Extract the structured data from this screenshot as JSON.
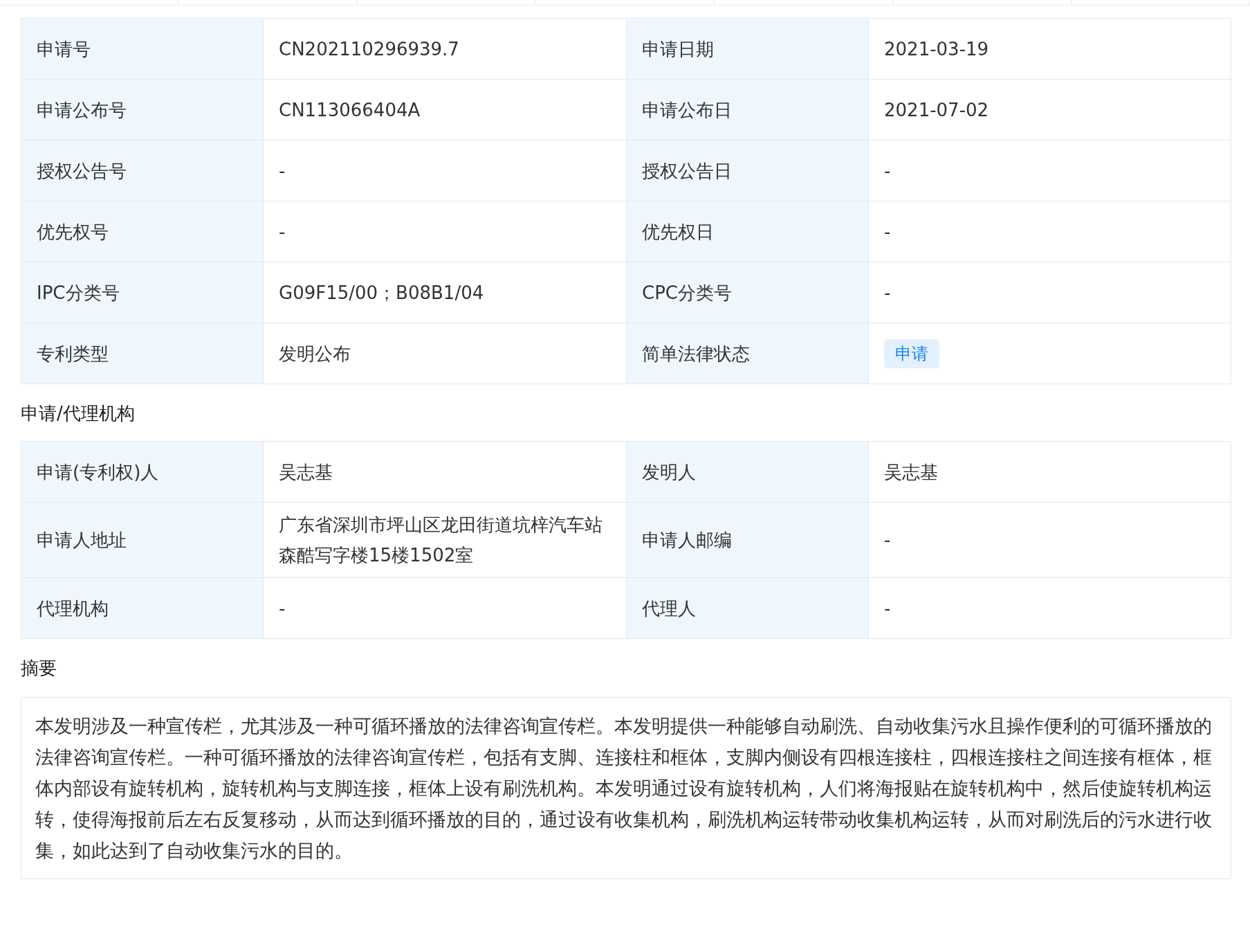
{
  "basic_info": {
    "rows": [
      [
        {
          "label": "申请号",
          "value": "CN202110296939.7"
        },
        {
          "label": "申请日期",
          "value": "2021-03-19"
        }
      ],
      [
        {
          "label": "申请公布号",
          "value": "CN113066404A"
        },
        {
          "label": "申请公布日",
          "value": "2021-07-02"
        }
      ],
      [
        {
          "label": "授权公告号",
          "value": "-"
        },
        {
          "label": "授权公告日",
          "value": "-"
        }
      ],
      [
        {
          "label": "优先权号",
          "value": "-"
        },
        {
          "label": "优先权日",
          "value": "-"
        }
      ],
      [
        {
          "label": "IPC分类号",
          "value": "G09F15/00；B08B1/04"
        },
        {
          "label": "CPC分类号",
          "value": "-"
        }
      ],
      [
        {
          "label": "专利类型",
          "value": "发明公布"
        },
        {
          "label": "简单法律状态",
          "value": "申请",
          "kind": "badge"
        }
      ]
    ]
  },
  "agency": {
    "title": "申请/代理机构",
    "rows": [
      [
        {
          "label": "申请(专利权)人",
          "value": "吴志基"
        },
        {
          "label": "发明人",
          "value": "吴志基"
        }
      ],
      [
        {
          "label": "申请人地址",
          "value": "广东省深圳市坪山区龙田街道坑梓汽车站森酷写字楼15楼1502室"
        },
        {
          "label": "申请人邮编",
          "value": "-"
        }
      ],
      [
        {
          "label": "代理机构",
          "value": "-"
        },
        {
          "label": "代理人",
          "value": "-"
        }
      ]
    ]
  },
  "abstract": {
    "title": "摘要",
    "text": "本发明涉及一种宣传栏，尤其涉及一种可循环播放的法律咨询宣传栏。本发明提供一种能够自动刷洗、自动收集污水且操作便利的可循环播放的法律咨询宣传栏。一种可循环播放的法律咨询宣传栏，包括有支脚、连接柱和框体，支脚内侧设有四根连接柱，四根连接柱之间连接有框体，框体内部设有旋转机构，旋转机构与支脚连接，框体上设有刷洗机构。本发明通过设有旋转机构，人们将海报贴在旋转机构中，然后使旋转机构运转，使得海报前后左右反复移动，从而达到循环播放的目的，通过设有收集机构，刷洗机构运转带动收集机构运转，从而对刷洗后的污水进行收集，如此达到了自动收集污水的目的。"
  }
}
